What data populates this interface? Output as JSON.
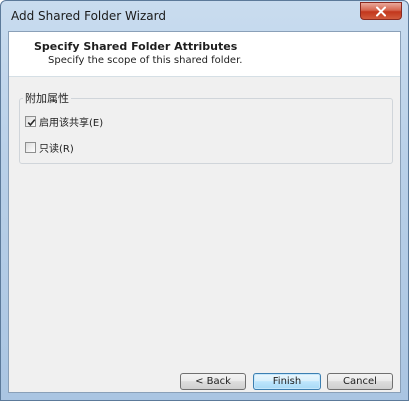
{
  "window": {
    "title": "Add Shared Folder Wizard"
  },
  "header": {
    "title": "Specify Shared Folder Attributes",
    "subtitle": "Specify the scope of this shared folder."
  },
  "group": {
    "label": "附加属性",
    "options": [
      {
        "label": "启用该共享(E)",
        "checked": true
      },
      {
        "label": "只读(R)",
        "checked": false
      }
    ]
  },
  "buttons": {
    "back": "< Back",
    "finish": "Finish",
    "cancel": "Cancel"
  },
  "colors": {
    "accent": "#3c7fb1",
    "close": "#c2361c"
  }
}
